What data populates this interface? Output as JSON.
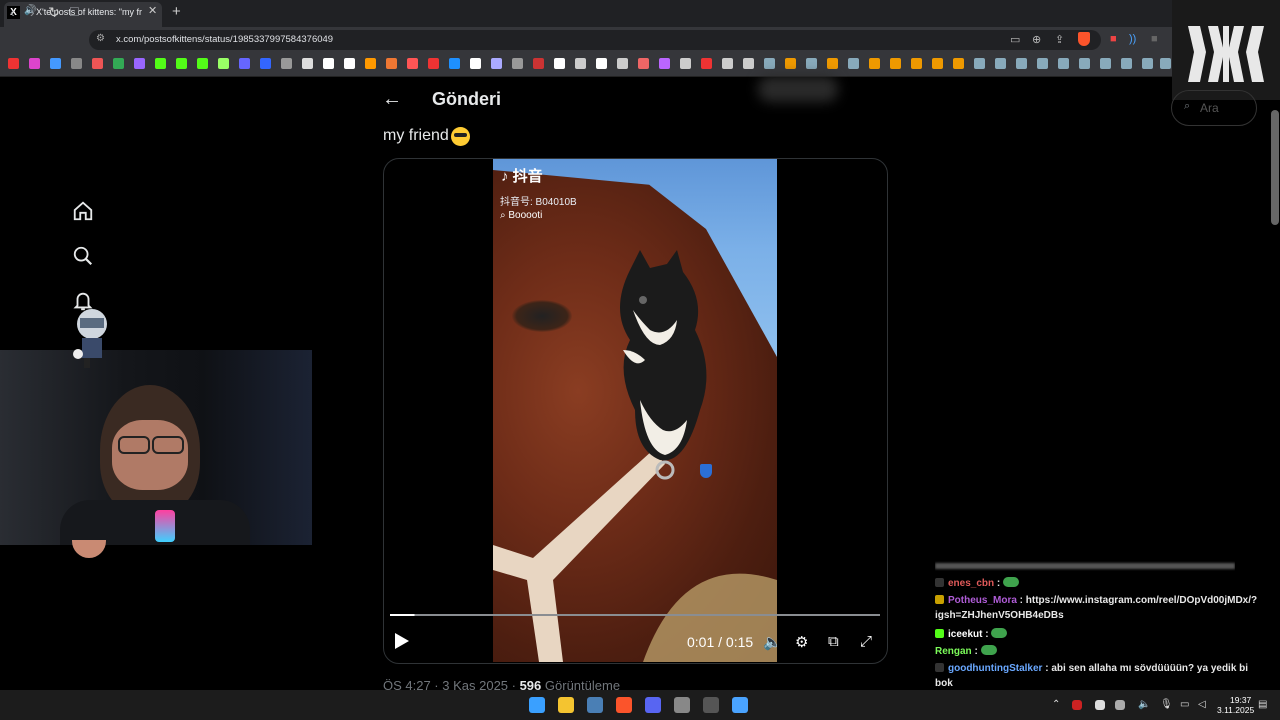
{
  "browser": {
    "tab_title": "X'te posts of kittens: \"my frien",
    "tab_close": "✕",
    "new_tab": "+",
    "url": "x.com/postsofkittens/status/1985337997584376049",
    "tab_favicon": "X",
    "audio_icon": "speaker-icon",
    "nav": {
      "back": "‹",
      "forward": "›",
      "reload": "↻",
      "bookmark": "☐"
    }
  },
  "page": {
    "back_symbol": "←",
    "title": "Gönderi",
    "search_placeholder": "Ara",
    "search_icon": "search-icon",
    "post_text": "my friend",
    "video": {
      "overlay_logo": "抖音",
      "overlay_id": "抖音号: B04010B",
      "overlay_user": "Booooti",
      "time": "0:01 / 0:15",
      "progress_percent": 5
    },
    "timestamp_prefix": "ÖS 4:27 · 3 Kas 2025 · ",
    "views_count": "596",
    "views_label": " Görüntüleme"
  },
  "chat": [
    {
      "user": "enes_cbn",
      "color": "#e05a5a",
      "badge": "#333",
      "text": " : ",
      "emote": true
    },
    {
      "user": "Potheus_Mora",
      "color": "#b05dd8",
      "badge": "#c8a000",
      "text": " : https://www.instagram.com/reel/DOpVd00jMDx/?igsh=ZHJhenV5OHB4eDBs",
      "emote": false
    },
    {
      "user": "iceekut",
      "color": "#ffffff",
      "badge": "#53fc18",
      "text": " : ",
      "emote": true
    },
    {
      "user": "Rengan",
      "color": "#7cfc5a",
      "badge": "",
      "text": " : ",
      "emote": true
    },
    {
      "user": "goodhuntingStalker",
      "color": "#6aa8ff",
      "badge": "#333",
      "text": " : abi sen allaha mı sövdüüüün? ya yedik bi bok",
      "emote": false
    }
  ],
  "taskbar": {
    "time": "19:37",
    "date": "3.11.2025"
  },
  "colors": {
    "accent": "#1d9bf0",
    "background": "#000000"
  }
}
